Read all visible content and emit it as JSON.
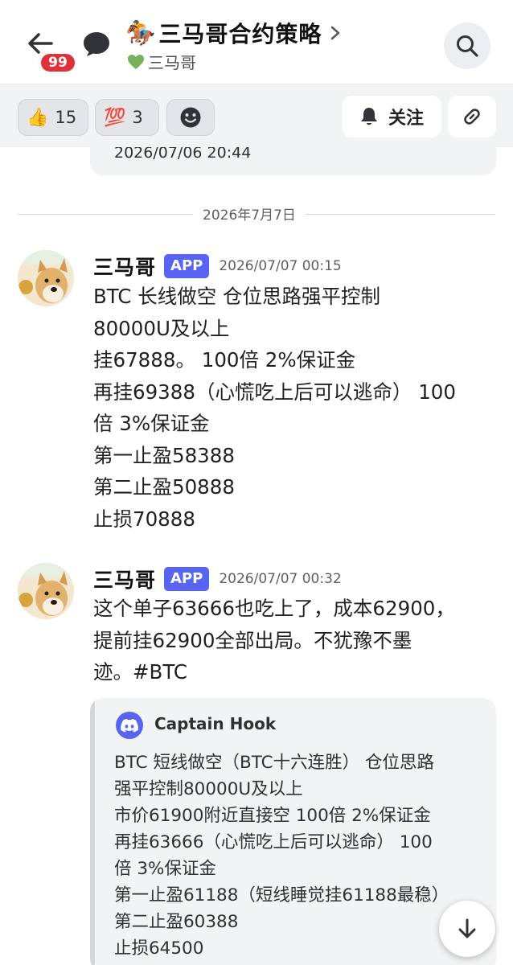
{
  "header": {
    "unread_count": "99",
    "title_emoji": "🏇",
    "title": "三马哥合约策略",
    "subtitle": "三马哥"
  },
  "reactions": [
    {
      "emoji": "👍",
      "count": "15"
    },
    {
      "emoji": "💯",
      "count": "3"
    }
  ],
  "actions": {
    "follow_label": "关注"
  },
  "previous_embed": {
    "timestamp": "2026/07/06 20:44"
  },
  "date_divider": "2026年7月7日",
  "messages": [
    {
      "author": "三马哥",
      "tag": "APP",
      "time": "2026/07/07 00:15",
      "lines": [
        "BTC 长线做空 仓位思路强平控制",
        "80000U及以上",
        "挂67888。 100倍 2%保证金",
        "再挂69388（心慌吃上后可以逃命） 100",
        "倍 3%保证金",
        "第一止盈58388",
        "第二止盈50888",
        "止损70888"
      ]
    },
    {
      "author": "三马哥",
      "tag": "APP",
      "time": "2026/07/07 00:32",
      "lines": [
        "这个单子63666也吃上了，成本62900，",
        "提前挂62900全部出局。不犹豫不墨",
        "迹。#BTC"
      ]
    }
  ],
  "embed": {
    "author": "Captain Hook",
    "lines": [
      "BTC 短线做空（BTC十六连胜） 仓位思路",
      "强平控制80000U及以上",
      "市价61900附近直接空 100倍 2%保证金",
      "再挂63666（心慌吃上后可以逃命） 100",
      "倍 3%保证金",
      "第一止盈61188（短线睡觉挂61188最稳）",
      "第二止盈60388",
      "止损64500"
    ]
  },
  "colors": {
    "accent": "#5865f2",
    "badge": "#e0303a",
    "heart": "#78b159"
  },
  "icons": [
    "back-arrow-icon",
    "chat-bubble-icon",
    "chevron-right-icon",
    "green-heart-icon",
    "search-icon",
    "smile-add-icon",
    "bell-icon",
    "link-icon",
    "discord-icon",
    "arrow-down-icon"
  ]
}
